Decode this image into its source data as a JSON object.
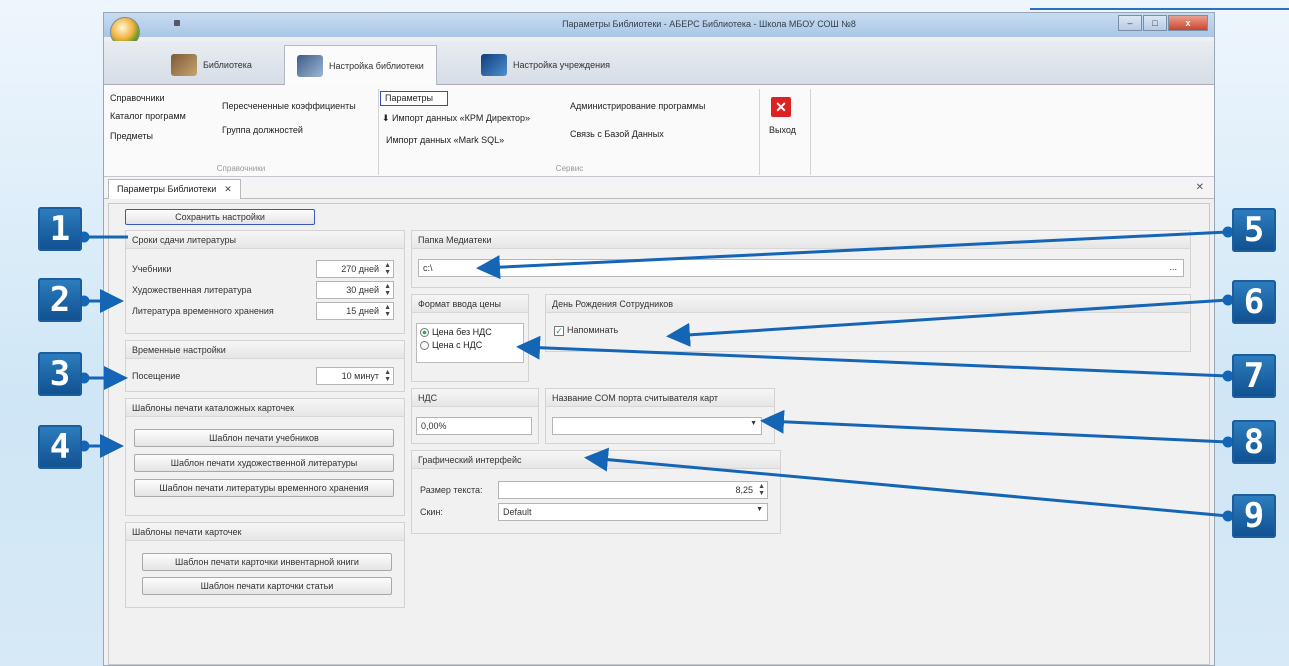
{
  "window": {
    "title": "Параметры Библиотеки - АБЕРС Библиотека - Школа МБОУ СОШ №8",
    "buttons": {
      "minimize": "–",
      "maximize": "□",
      "close": "x"
    }
  },
  "ribbon_tabs": [
    {
      "label": "Библиотека",
      "icon": "books-icon"
    },
    {
      "label": "Настройка библиотеки",
      "icon": "library-settings-icon"
    },
    {
      "label": "Настройка учреждения",
      "icon": "institution-settings-icon"
    }
  ],
  "ribbon": {
    "group1": {
      "items": [
        "Справочники",
        "Каталог программ",
        "Предметы"
      ],
      "items2": [
        "Пересчененные коэффициенты",
        "Группа должностей"
      ],
      "caption": "Справочники"
    },
    "group2": {
      "params": "Параметры",
      "import1": "Импорт данных «КРМ Директор»",
      "import2": "Импорт данных «Mark SQL»",
      "admin": "Администрирование программы",
      "db": "Связь с Базой Данных",
      "caption": "Сервис"
    },
    "group3": {
      "exit": "Выход"
    }
  },
  "doc_tab": {
    "label": "Параметры Библиотеки",
    "close": "✕"
  },
  "content": {
    "save_button": "Сохранить настройки",
    "deadlines": {
      "title": "Сроки сдачи литературы",
      "rows": [
        {
          "label": "Учебники",
          "value": "270 дней"
        },
        {
          "label": "Художественная литература",
          "value": "30 дней"
        },
        {
          "label": "Литература временного хранения",
          "value": "15 дней"
        }
      ]
    },
    "time": {
      "title": "Временные настройки",
      "label": "Посещение",
      "value": "10 минут"
    },
    "catalog_templates": {
      "title": "Шаблоны печати каталожных карточек",
      "buttons": [
        "Шаблон печати учебников",
        "Шаблон печати художественной литературы",
        "Шаблон печати литературы временного хранения"
      ]
    },
    "card_templates": {
      "title": "Шаблоны печати карточек",
      "buttons": [
        "Шаблон печати карточки инвентарной книги",
        "Шаблон печати карточки статьи"
      ]
    },
    "media": {
      "title": "Папка Медиатеки",
      "value": "c:\\",
      "browse": "..."
    },
    "price": {
      "title": "Формат ввода цены",
      "opt1": "Цена без НДС",
      "opt2": "Цена с НДС"
    },
    "birthday": {
      "title": "День Рождения Сотрудников",
      "check": "Напоминать"
    },
    "vat": {
      "title": "НДС",
      "value": "0,00%"
    },
    "com": {
      "title": "Название COM порта считывателя карт",
      "value": ""
    },
    "gui": {
      "title": "Графический интерфейс",
      "size_label": "Размер текста:",
      "size_value": "8,25",
      "skin_label": "Скин:",
      "skin_value": "Default"
    }
  },
  "callouts": [
    "1",
    "2",
    "3",
    "4",
    "5",
    "6",
    "7",
    "8",
    "9"
  ]
}
